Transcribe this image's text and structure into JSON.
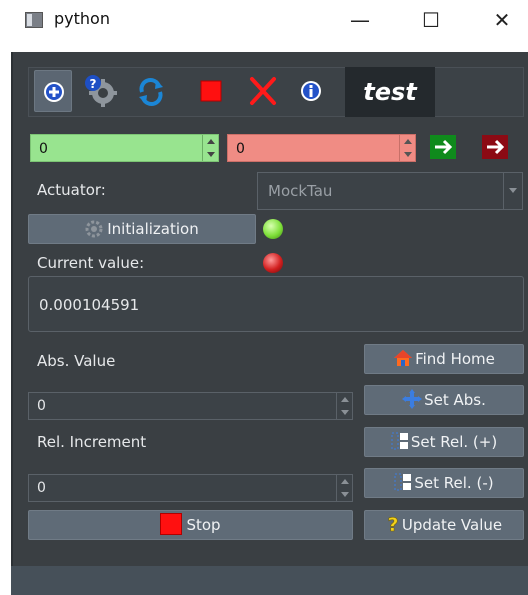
{
  "window": {
    "title": "python",
    "minimize": "—",
    "maximize": "☐",
    "close": "✕"
  },
  "toolbar": {
    "buttons": [
      {
        "name": "add-icon",
        "glyph": "+"
      },
      {
        "name": "settings-help-icon"
      },
      {
        "name": "refresh-icon",
        "glyph": "⟳"
      },
      {
        "name": "stop-square-icon"
      },
      {
        "name": "close-x-icon",
        "glyph": "✕"
      },
      {
        "name": "info-icon",
        "glyph": "i"
      }
    ],
    "tab_label": "test"
  },
  "limits": {
    "lower": "0",
    "upper": "0"
  },
  "actuator": {
    "label": "Actuator:",
    "value": "MockTau"
  },
  "init_button": "Initialization",
  "current_value": {
    "label": "Current value:",
    "value": "0.000104591"
  },
  "abs": {
    "label": "Abs. Value",
    "value": "0"
  },
  "rel": {
    "label": "Rel. Increment",
    "value": "0"
  },
  "buttons": {
    "find_home": "Find Home",
    "set_abs": "Set Abs.",
    "set_rel_plus": "Set Rel. (+)",
    "set_rel_minus": "Set Rel. (-)",
    "stop": "Stop",
    "update_value": "Update Value"
  },
  "colors": {
    "lower_bg": "#98e48f",
    "upper_bg": "#f08c84",
    "led_green": "#7fe03a",
    "led_red": "#d21f1f",
    "panel": "#3a3f43"
  }
}
